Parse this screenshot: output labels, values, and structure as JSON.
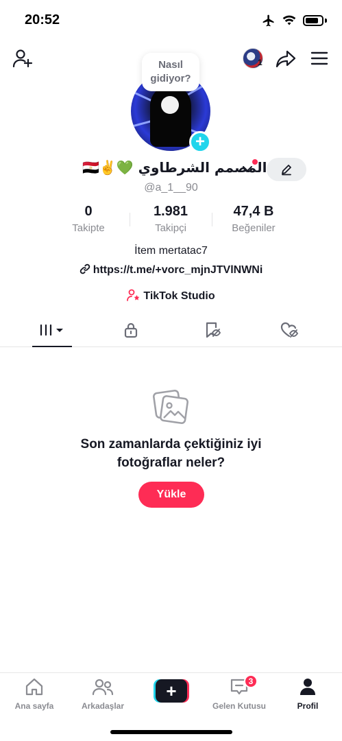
{
  "status_bar": {
    "time": "20:52"
  },
  "header": {
    "notification_count": "1"
  },
  "profile": {
    "bubble_text": "Nasıl\ngidiyor?",
    "display_name": "🇪🇬✌️💚 المصمم الشرطاوي",
    "username": "@a_1__90",
    "bio": "İtem mertatac7",
    "link": "https://t.me/+vorc_mjnJTVlNWNi",
    "studio_label": "TikTok Studio"
  },
  "stats": [
    {
      "value": "0",
      "label": "Takipte"
    },
    {
      "value": "1.981",
      "label": "Takipçi"
    },
    {
      "value": "47,4 B",
      "label": "Beğeniler"
    }
  ],
  "empty_state": {
    "title": "Son zamanlarda çektiğiniz iyi\nfotoğraflar neler?",
    "button": "Yükle"
  },
  "bottom_nav": {
    "home": "Ana sayfa",
    "friends": "Arkadaşlar",
    "inbox": "Gelen Kutusu",
    "inbox_badge": "3",
    "profile": "Profil"
  },
  "colors": {
    "accent": "#fe2c55",
    "cyan": "#20d5ec",
    "text": "#161823",
    "muted": "#8a8b91"
  },
  "icons": [
    "airplane-icon",
    "wifi-icon",
    "battery-icon",
    "add-friend-icon",
    "share-icon",
    "menu-icon",
    "edit-icon",
    "link-icon",
    "studio-icon",
    "grid-icon",
    "lock-icon",
    "saved-icon",
    "liked-icon",
    "photo-icon",
    "home-icon",
    "friends-icon",
    "create-icon",
    "inbox-icon",
    "profile-icon"
  ]
}
